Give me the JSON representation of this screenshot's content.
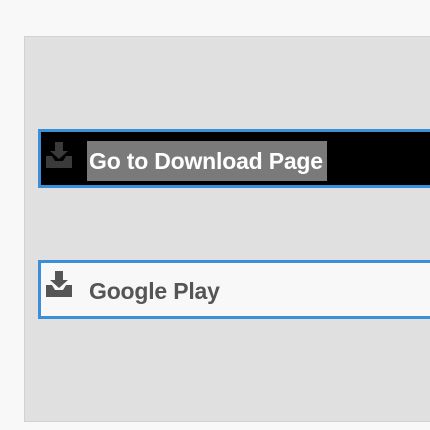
{
  "buttons": {
    "download_page": {
      "label": "Go to Download Page",
      "icon": "download-tray-icon"
    },
    "google_play": {
      "label": "Google Play",
      "icon": "download-tray-icon"
    }
  },
  "colors": {
    "accent_border": "#3a8fd6",
    "panel_background": "#e0e0e0",
    "primary_button_background": "#000000",
    "primary_label_highlight": "#7a7a7a",
    "secondary_button_background": "#f8f8f8",
    "secondary_label_color": "#555555"
  }
}
